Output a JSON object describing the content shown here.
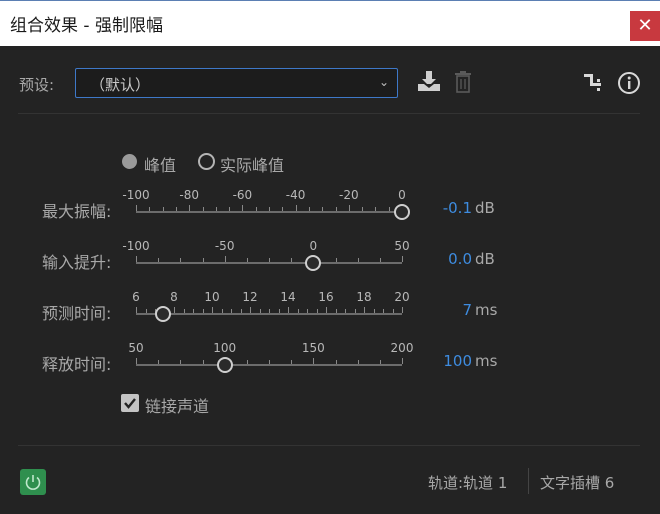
{
  "window": {
    "title": "组合效果 - 强制限幅",
    "close": "✕"
  },
  "preset": {
    "label": "预设:",
    "value": "（默认）"
  },
  "mode": {
    "options": [
      "峰值",
      "实际峰值"
    ],
    "selected": "峰值"
  },
  "params": [
    {
      "label": "最大振幅:",
      "ticks": [
        "-100",
        "-80",
        "-60",
        "-40",
        "-20",
        "0"
      ],
      "value": "-0.1",
      "unit": "dB",
      "level": 0.999
    },
    {
      "label": "输入提升:",
      "ticks": [
        "-100",
        "-50",
        "0",
        "50"
      ],
      "value": "0.0",
      "unit": "dB",
      "level": 0.6667
    },
    {
      "label": "预测时间:",
      "ticks": [
        "6",
        "8",
        "10",
        "12",
        "14",
        "16",
        "18",
        "20"
      ],
      "value": "7",
      "unit": "ms",
      "level": 0.1
    },
    {
      "label": "释放时间:",
      "ticks": [
        "50",
        "100",
        "150",
        "200"
      ],
      "value": "100",
      "unit": "ms",
      "level": 0.3333
    }
  ],
  "link": {
    "label": "链接声道",
    "checked": true
  },
  "footer": {
    "track": "轨道:轨道 1",
    "slot": "文字插槽 6"
  },
  "colors": {
    "accent": "#3e8ce0",
    "power": "#2f8f4e",
    "close": "#c8393f",
    "selection_border": "#3e78c8"
  }
}
